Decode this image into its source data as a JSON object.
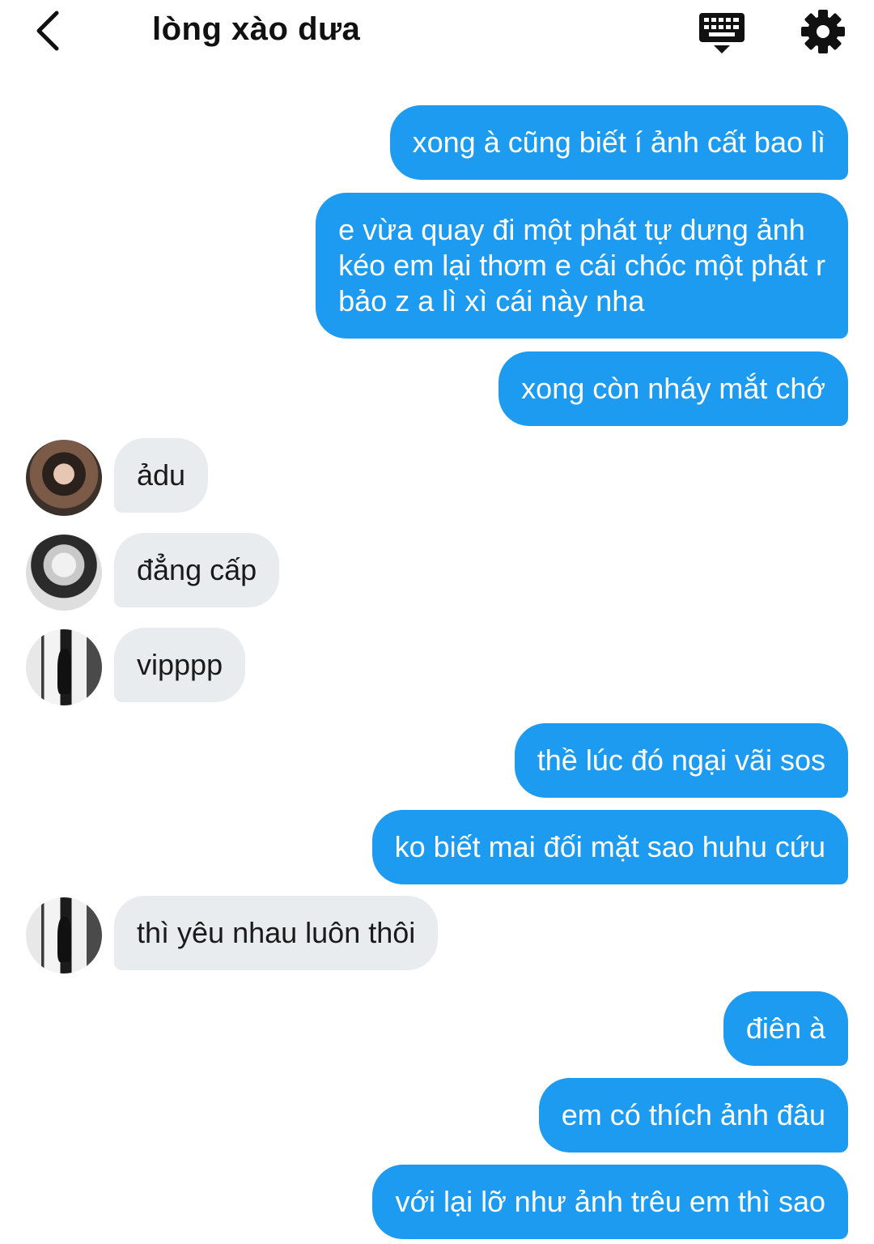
{
  "header": {
    "back_icon": "chevron-left-icon",
    "title": "lòng xào dưa",
    "keyboard_icon": "keyboard-icon",
    "settings_icon": "gear-icon"
  },
  "colors": {
    "outgoing_bubble": "#1d9bf0",
    "incoming_bubble": "#e9ecef"
  },
  "messages": [
    {
      "side": "out",
      "text": "xong à cũng biết í ảnh cất bao lì"
    },
    {
      "side": "out",
      "lines": [
        "e vừa quay đi một phát tự dưng ảnh",
        "kéo em lại thơm e cái chóc một phát r",
        "bảo z a lì xì cái này nha"
      ]
    },
    {
      "side": "out",
      "text": "xong còn nháy mắt chớ"
    },
    {
      "side": "in",
      "text": "ảdu"
    },
    {
      "side": "in",
      "text": "đẳng cấp"
    },
    {
      "side": "in",
      "text": "vipppp"
    },
    {
      "side": "out",
      "text": "thề lúc đó ngại vãi sos"
    },
    {
      "side": "out",
      "text": "ko biết mai đối mặt sao huhu cứu"
    },
    {
      "side": "in",
      "text": "thì yêu nhau luôn thôi"
    },
    {
      "side": "out",
      "text": "điên à"
    },
    {
      "side": "out",
      "text": "em có thích ảnh đâu"
    },
    {
      "side": "out",
      "text": "với lại lỡ như ảnh trêu em thì sao"
    }
  ]
}
